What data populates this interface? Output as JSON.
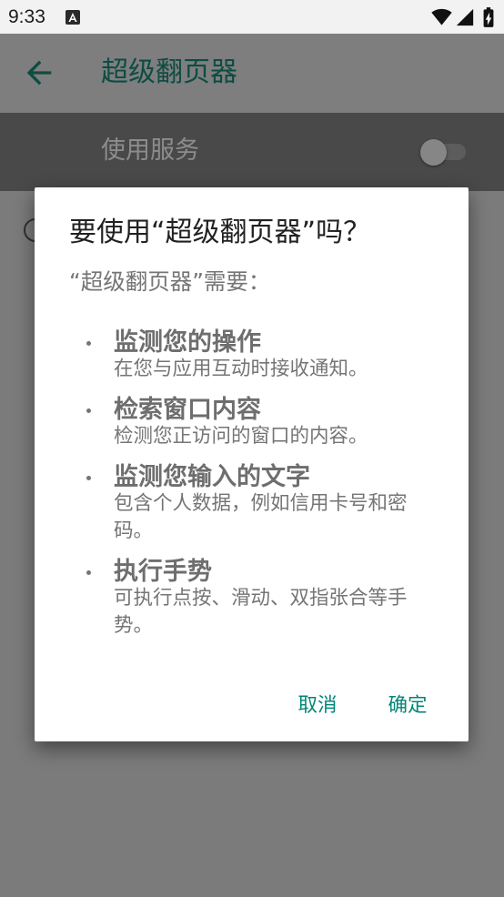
{
  "status_bar": {
    "time": "9:33",
    "icons": [
      "a-notification-icon",
      "wifi-icon",
      "signal-icon",
      "battery-charging-icon"
    ]
  },
  "app_bar": {
    "back_icon": "arrow-back-icon",
    "title": "超级翻页器"
  },
  "settings": {
    "use_service": {
      "label": "使用服务",
      "enabled": false
    }
  },
  "dialog": {
    "title": "要使用“超级翻页器”吗？",
    "message": "“超级翻页器”需要：",
    "permissions": [
      {
        "title": "监测您的操作",
        "description": "在您与应用互动时接收通知。"
      },
      {
        "title": "检索窗口内容",
        "description": "检测您正访问的窗口的内容。"
      },
      {
        "title": "监测您输入的文字",
        "description": "包含个人数据，例如信用卡号和密码。"
      },
      {
        "title": "执行手势",
        "description": "可执行点按、滑动、双指张合等手势。"
      }
    ],
    "buttons": {
      "cancel": "取消",
      "confirm": "确定"
    }
  },
  "colors": {
    "accent": "#008577",
    "dialog_title": "#212121",
    "secondary_text": "#757575"
  }
}
